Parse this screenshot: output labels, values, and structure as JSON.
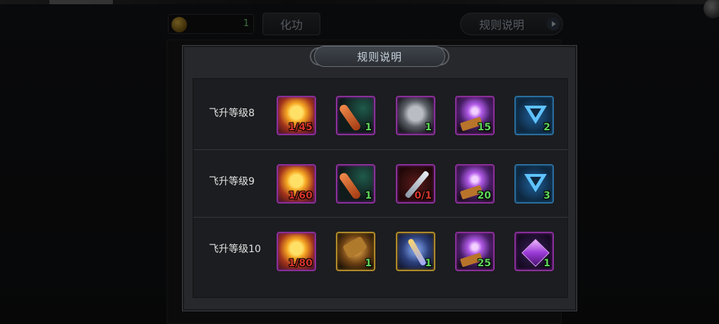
{
  "header": {
    "currency_value": "1",
    "huagong_label": "化功",
    "rules_button_label": "规则说明"
  },
  "modal": {
    "title": "规则说明",
    "rows": [
      {
        "label": "飞升等级8",
        "items": [
          {
            "icon": "sun-stone-icon",
            "count": "1/45",
            "count_color": "red"
          },
          {
            "icon": "flame-blade-icon",
            "count": "1",
            "count_color": "green"
          },
          {
            "icon": "armor-icon",
            "count": "1",
            "count_color": "green"
          },
          {
            "icon": "purple-orb-scroll-icon",
            "count": "15",
            "count_color": "green"
          },
          {
            "icon": "blue-triangle-crystal-icon",
            "count": "2",
            "count_color": "green"
          }
        ]
      },
      {
        "label": "飞升等级9",
        "items": [
          {
            "icon": "sun-stone-icon",
            "count": "1/60",
            "count_color": "red"
          },
          {
            "icon": "flame-blade-icon",
            "count": "1",
            "count_color": "green"
          },
          {
            "icon": "silver-sword-icon",
            "count": "0/1",
            "count_color": "red"
          },
          {
            "icon": "purple-orb-scroll-icon",
            "count": "20",
            "count_color": "green"
          },
          {
            "icon": "blue-triangle-crystal-icon",
            "count": "3",
            "count_color": "green"
          }
        ]
      },
      {
        "label": "飞升等级10",
        "items": [
          {
            "icon": "sun-stone-icon",
            "count": "1/80",
            "count_color": "red"
          },
          {
            "icon": "golden-hammer-icon",
            "count": "1",
            "count_color": "green"
          },
          {
            "icon": "feather-staff-icon",
            "count": "1",
            "count_color": "green"
          },
          {
            "icon": "purple-orb-scroll-icon",
            "count": "25",
            "count_color": "green"
          },
          {
            "icon": "purple-gem-icon",
            "count": "1",
            "count_color": "green"
          }
        ]
      }
    ]
  },
  "colors": {
    "count_red": "#d6352b",
    "count_green": "#5ed65a",
    "frame_purple": "#8a2f9a",
    "frame_gold": "#b08a2a",
    "frame_blue": "#2a6e9e"
  }
}
